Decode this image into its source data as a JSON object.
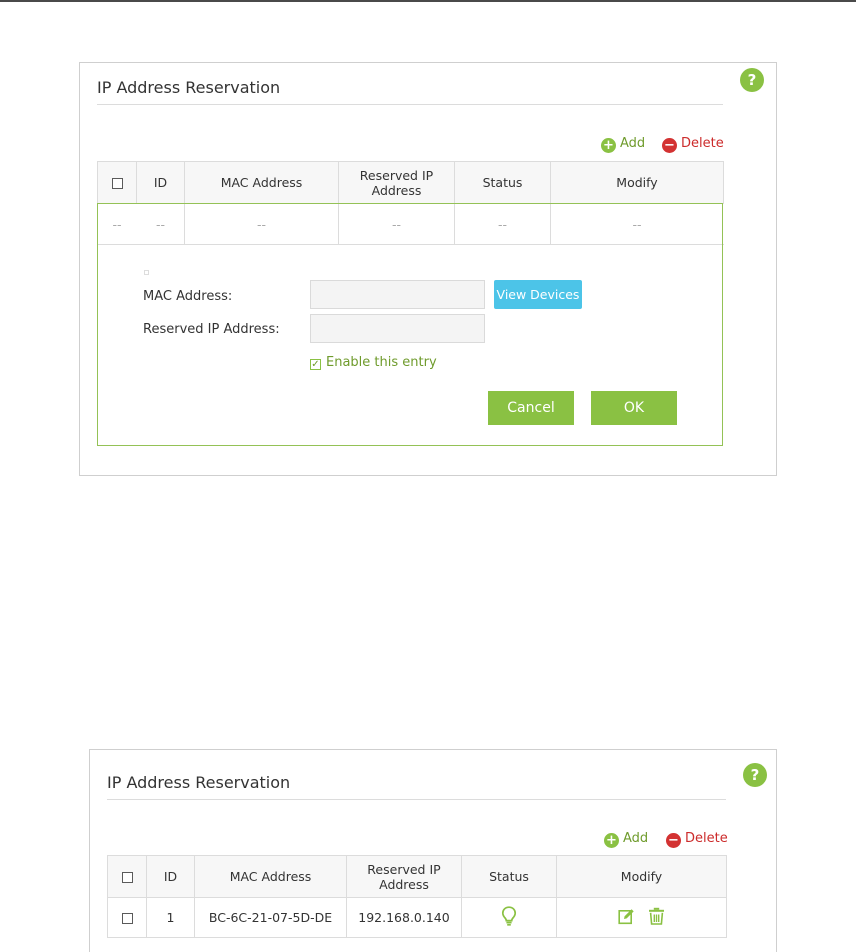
{
  "panel1": {
    "title": "IP Address Reservation",
    "help": "?",
    "add_label": "Add",
    "delete_label": "Delete",
    "columns": [
      "ID",
      "MAC Address",
      "Reserved IP Address",
      "Status",
      "Modify"
    ],
    "empty_row": [
      "--",
      "--",
      "--",
      "--",
      "--",
      "--"
    ],
    "form": {
      "mac_label": "MAC Address:",
      "mac_value": "",
      "ip_label": "Reserved IP Address:",
      "ip_value": "",
      "view_devices_label": "View Devices",
      "enable_label": "Enable this entry",
      "enable_checked": true,
      "cancel_label": "Cancel",
      "ok_label": "OK"
    }
  },
  "panel2": {
    "title": "IP Address Reservation",
    "help": "?",
    "add_label": "Add",
    "delete_label": "Delete",
    "columns": [
      "ID",
      "MAC Address",
      "Reserved IP Address",
      "Status",
      "Modify"
    ],
    "rows": [
      {
        "id": "1",
        "mac": "BC-6C-21-07-5D-DE",
        "ip": "192.168.0.140",
        "status_icon": "lightbulb-icon",
        "modify_icons": [
          "edit-icon",
          "trash-icon"
        ]
      }
    ]
  },
  "colors": {
    "accent_green": "#8ac143",
    "delete_red": "#d33232",
    "button_blue": "#4cc4e8",
    "form_border_green": "#94c256"
  }
}
